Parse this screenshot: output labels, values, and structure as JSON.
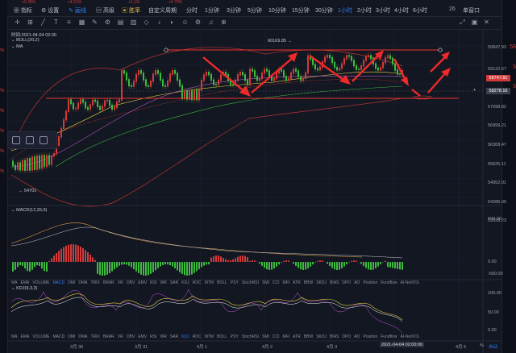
{
  "left_strip": {
    "items": [
      "%",
      "%",
      "%",
      "%",
      "%",
      "%"
    ]
  },
  "toolbar": {
    "tickers": [
      "+0.38%",
      "+4.51%",
      "+1.1%",
      "+4.79%"
    ],
    "items": [
      {
        "label": "指标",
        "icon": "grid-icon",
        "active": false
      },
      {
        "label": "设置",
        "icon": "gear-icon",
        "active": false
      },
      {
        "label": "画线",
        "icon": "pen-icon",
        "active": true
      },
      {
        "label": "高级",
        "icon": "chart-icon",
        "active": false
      },
      {
        "label": "胜率",
        "icon": "chart-bar-icon",
        "active": false
      },
      {
        "label": "自定义周期",
        "icon": "",
        "active": false
      },
      {
        "label": "分时",
        "active": false
      },
      {
        "label": "1分钟",
        "active": false
      },
      {
        "label": "3分钟",
        "active": false
      },
      {
        "label": "5分钟",
        "active": false
      },
      {
        "label": "10分钟",
        "active": false
      },
      {
        "label": "15分钟",
        "active": false
      },
      {
        "label": "30分钟",
        "active": false
      },
      {
        "label": "1小时",
        "active": true
      },
      {
        "label": "2小时",
        "active": false
      },
      {
        "label": "3小时",
        "active": false
      },
      {
        "label": "4小时",
        "active": false
      },
      {
        "label": "6小时",
        "active": false
      }
    ],
    "right_num": "26",
    "right_label": "单窗口"
  },
  "main": {
    "time_label": "时间:2021-04-04 02:00",
    "boll_label": "BOLL(20,2)",
    "ma_label": "MA",
    "high_label": "60169.85",
    "low_label": "54701",
    "price_axis": [
      "59847.93",
      "59122.67",
      "58747.81",
      "58278.16",
      "57698.82",
      "56999.21",
      "56308.47",
      "55625.11",
      "54952.01",
      "54286.09",
      "53628.23"
    ],
    "current_price": "58747.81",
    "cursor_price": "58278.16",
    "macd_label": "MACD(12,26,9)",
    "macd_axis": [
      "500.00",
      "0.00",
      "-500.00"
    ],
    "kdj_label": "KDJ(9,3,3)",
    "kdj_axis": [
      "100.00",
      "50.00",
      "0.00"
    ],
    "indicators_row1": [
      "MA",
      "EMA",
      "VOLUME",
      "MACD",
      "DMI",
      "DMA",
      "TRIX",
      "BRAR",
      "VR",
      "OBV",
      "EMV",
      "RSI",
      "WR",
      "SAR",
      "KDJ",
      "ROC",
      "MTM",
      "BOLL",
      "PSY",
      "StochRSI",
      "SMI",
      "CCI",
      "MFI",
      "ATR",
      "BBW",
      "SKDJ",
      "BIAS",
      "DPO",
      "AO",
      "Position",
      "Fundflow",
      "AI-NetVOL"
    ],
    "indicators_row2": [
      "MA",
      "EMA",
      "VOLUME",
      "MACD",
      "DMI",
      "DMA",
      "TRIX",
      "BRAR",
      "VR",
      "OBV",
      "EMV",
      "RSI",
      "WR",
      "SAR",
      "KDJ",
      "ROC",
      "MTM",
      "BOLL",
      "PSY",
      "StochRSI",
      "SMI",
      "CCI",
      "MFI",
      "ATR",
      "BBW",
      "SKDJ",
      "BIAS",
      "DPO",
      "AO",
      "Position",
      "Fundflow",
      "AI-NetVOL"
    ],
    "active_indicator_row1": "MACD",
    "active_indicator_row2": "KDJ",
    "dates": [
      "3月 30",
      "3月 31",
      "4月 1",
      "4月 2",
      "4月 3",
      "4月 5"
    ],
    "cursor_date": "2021-04-04 02:00:00",
    "bottom_right": [
      "%",
      "自动"
    ]
  },
  "right_strip": {
    "values": [
      "56",
      "5",
      "5"
    ]
  },
  "colors": {
    "up": "#d43a3a",
    "down": "#3dbb3d",
    "accent": "#2f7ff0",
    "bg": "#131722"
  }
}
